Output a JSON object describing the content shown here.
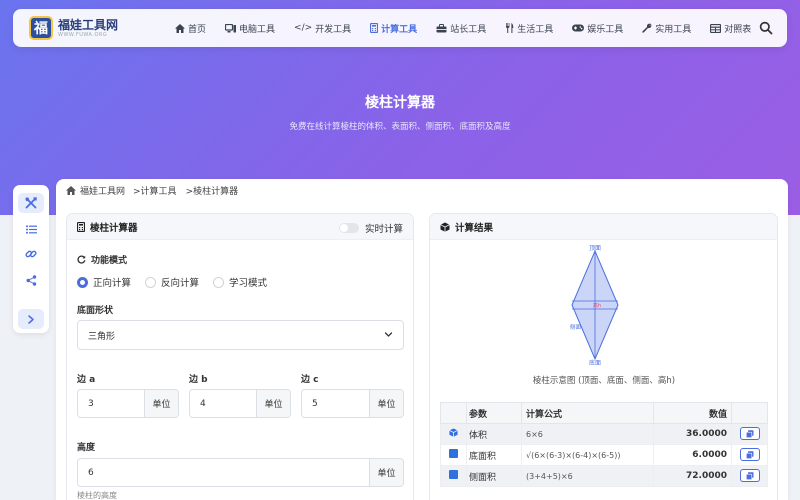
{
  "logo": {
    "char": "福",
    "name": "福娃工具网",
    "sub": "WWW.FUWA.ORG"
  },
  "nav": [
    {
      "label": "首页",
      "icon": "home-icon"
    },
    {
      "label": "电脑工具",
      "icon": "computer-icon"
    },
    {
      "label": "开发工具",
      "icon": "code-icon"
    },
    {
      "label": "计算工具",
      "icon": "calculator-icon",
      "active": true
    },
    {
      "label": "站长工具",
      "icon": "toolbox-icon"
    },
    {
      "label": "生活工具",
      "icon": "utensils-icon"
    },
    {
      "label": "娱乐工具",
      "icon": "gamepad-icon"
    },
    {
      "label": "实用工具",
      "icon": "wrench-icon"
    },
    {
      "label": "对照表",
      "icon": "table-icon"
    }
  ],
  "hero": {
    "title": "棱柱计算器",
    "subtitle": "免费在线计算棱柱的体积、表面积、侧面积、底面积及高度"
  },
  "breadcrumb": {
    "home": "福娃工具网",
    "level1": ">计算工具",
    "level2": ">棱柱计算器"
  },
  "calculator": {
    "title": "棱柱计算器",
    "realtime_label": "实时计算",
    "mode_label": "功能模式",
    "modes": [
      "正向计算",
      "反向计算",
      "学习模式"
    ],
    "base_shape_label": "底面形状",
    "base_shape_value": "三角形",
    "side_a_label": "边 a",
    "side_a_value": "3",
    "side_b_label": "边 b",
    "side_b_value": "4",
    "side_c_label": "边 c",
    "side_c_value": "5",
    "height_label": "高度",
    "height_value": "6",
    "unit": "单位",
    "height_hint": "棱柱的高度"
  },
  "result": {
    "title": "计算结果",
    "diagram_labels": {
      "top": "顶面",
      "bottom": "底面",
      "side": "侧面",
      "height": "高h"
    },
    "caption": "棱柱示意图 (顶面、底面、侧面、高h)",
    "headers": {
      "param": "参数",
      "formula": "计算公式",
      "value": "数值"
    },
    "rows": [
      {
        "icon": "cube-icon",
        "name": "体积",
        "formula": "6×6",
        "value": "36.0000"
      },
      {
        "icon": "square-icon",
        "name": "底面积",
        "formula": "√(6×(6-3)×(6-4)×(6-5))",
        "value": "6.0000"
      },
      {
        "icon": "square-icon",
        "name": "侧面积",
        "formula": "(3+4+5)×6",
        "value": "72.0000"
      }
    ]
  }
}
